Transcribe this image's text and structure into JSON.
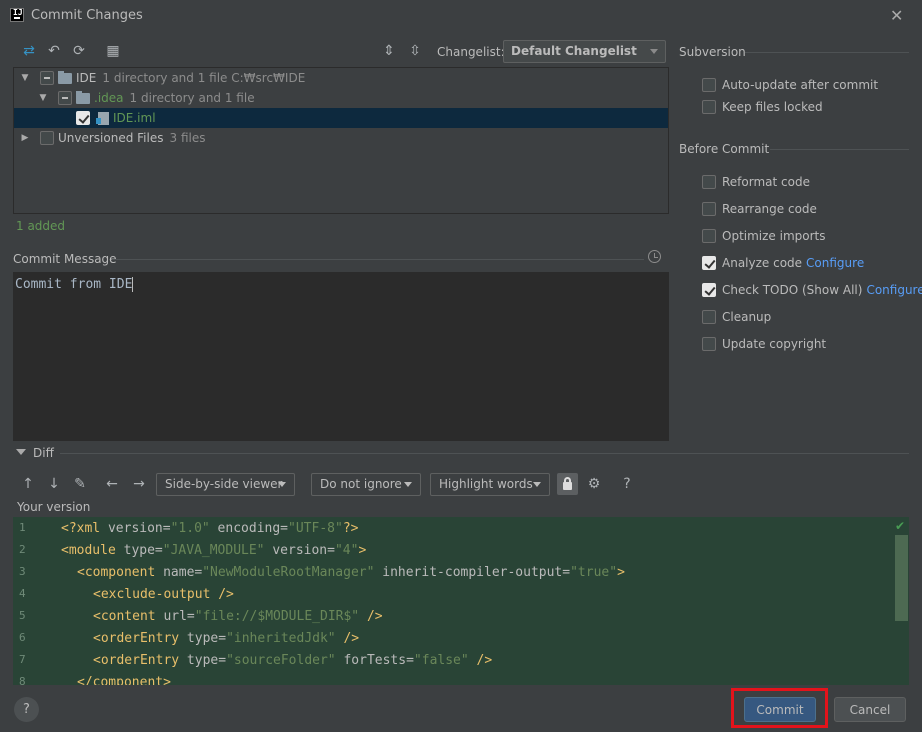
{
  "window": {
    "title": "Commit Changes"
  },
  "toolbar": {
    "changelist_label": "Changelist:",
    "changelist_value": "Default Changelist"
  },
  "tree": {
    "rows": [
      {
        "name": "IDE",
        "meta": "1 directory and 1 file  C:₩src₩IDE"
      },
      {
        "name": ".idea",
        "meta": "1 directory and 1 file"
      },
      {
        "name": "IDE.iml",
        "meta": ""
      },
      {
        "name": "Unversioned Files",
        "meta": "3 files"
      }
    ]
  },
  "status": {
    "added": "1 added"
  },
  "commit_message": {
    "label": "Commit Message",
    "text": "Commit from IDE"
  },
  "subversion": {
    "title": "Subversion",
    "options": [
      {
        "label": "Auto-update after commit",
        "checked": false
      },
      {
        "label": "Keep files locked",
        "checked": false
      }
    ]
  },
  "before_commit": {
    "title": "Before Commit",
    "options": [
      {
        "label": "Reformat code",
        "checked": false
      },
      {
        "label": "Rearrange code",
        "checked": false
      },
      {
        "label": "Optimize imports",
        "checked": false
      },
      {
        "label": "Analyze code",
        "checked": true,
        "link": "Configure"
      },
      {
        "label": "Check TODO (Show All)",
        "checked": true,
        "link": "Configure"
      },
      {
        "label": "Cleanup",
        "checked": false
      },
      {
        "label": "Update copyright",
        "checked": false
      }
    ]
  },
  "diff": {
    "title": "Diff",
    "viewer": "Side-by-side viewer",
    "ignore": "Do not ignore",
    "highlight": "Highlight words",
    "help": "?",
    "your_version": "Your version",
    "line_numbers": [
      "1",
      "2",
      "3",
      "4",
      "5",
      "6",
      "7",
      "8"
    ]
  },
  "buttons": {
    "help": "?",
    "commit": "Commit",
    "cancel": "Cancel"
  },
  "colors": {
    "accent_link": "#589df6",
    "highlight_box": "#e3131b",
    "added_green": "#629755"
  }
}
